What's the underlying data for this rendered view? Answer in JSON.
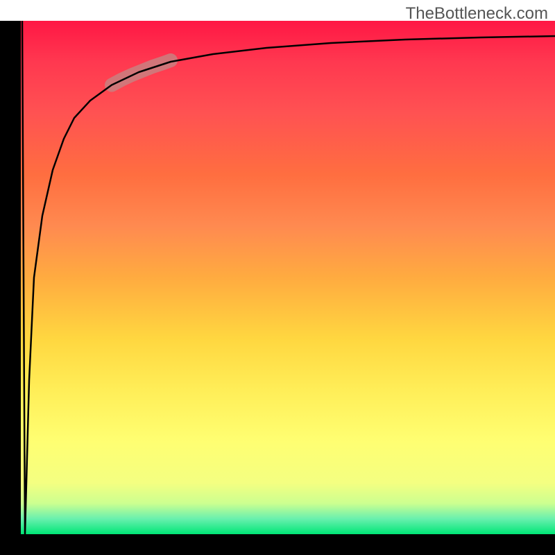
{
  "attribution": "TheBottleneck.com",
  "chart_data": {
    "type": "line",
    "title": "",
    "xlabel": "",
    "ylabel": "",
    "x": [
      0,
      0.008,
      0.015,
      0.025,
      0.04,
      0.06,
      0.08,
      0.1,
      0.13,
      0.17,
      0.22,
      0.28,
      0.36,
      0.46,
      0.58,
      0.72,
      0.86,
      1.0
    ],
    "values": [
      100,
      0,
      30,
      50,
      62,
      71,
      77,
      81,
      84.5,
      87.5,
      90,
      92,
      93.5,
      94.7,
      95.7,
      96.4,
      96.8,
      97.0
    ],
    "ylim": [
      0,
      100
    ],
    "xlim": [
      0,
      1
    ],
    "background_gradient": {
      "top": "#ff1744",
      "mid": "#ffd740",
      "bottom": "#00e676"
    },
    "highlight_segment": {
      "x_range": [
        0.17,
        0.28
      ],
      "color": "#c98080"
    }
  }
}
